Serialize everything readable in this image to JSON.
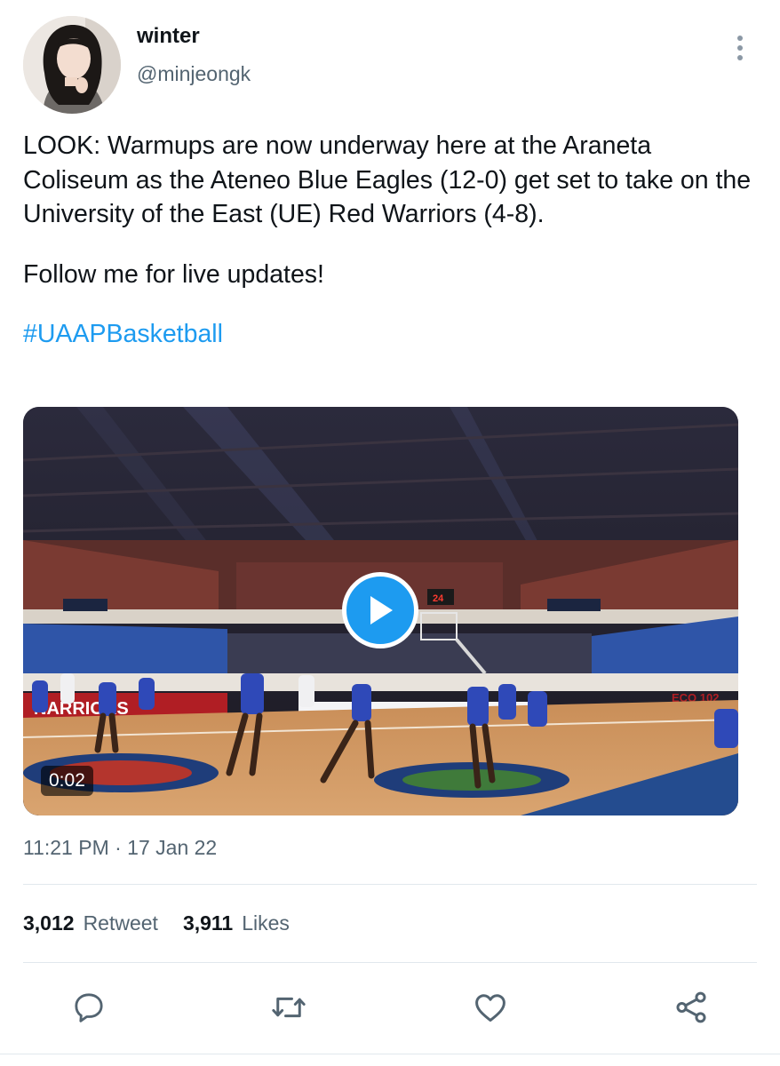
{
  "author": {
    "display_name": "winter",
    "handle": "@minjeongk"
  },
  "tweet": {
    "paragraphs": [
      "LOOK: Warmups are now underway here at the Araneta Coliseum as the Ateneo Blue Eagles (12-0) get set to take on the University of the East (UE) Red Warriors (4-8).",
      "Follow me for live updates!"
    ],
    "hashtag": "#UAAPBasketball"
  },
  "media": {
    "duration": "0:02",
    "court_text_1": "NARRIORS",
    "court_text_2": "ECO 102",
    "shot_clock": "24"
  },
  "meta": {
    "timestamp": "11:21 PM · 17 Jan 22"
  },
  "stats": {
    "retweets_count": "3,012",
    "retweets_label": "Retweet",
    "likes_count": "3,911",
    "likes_label": "Likes"
  },
  "actions": [
    {
      "name": "reply-icon"
    },
    {
      "name": "retweet-icon"
    },
    {
      "name": "like-icon"
    },
    {
      "name": "share-icon"
    }
  ],
  "colors": {
    "accent": "#1d9bf0",
    "text_primary": "#0f1419",
    "text_secondary": "#536471",
    "icon": "#536471"
  }
}
